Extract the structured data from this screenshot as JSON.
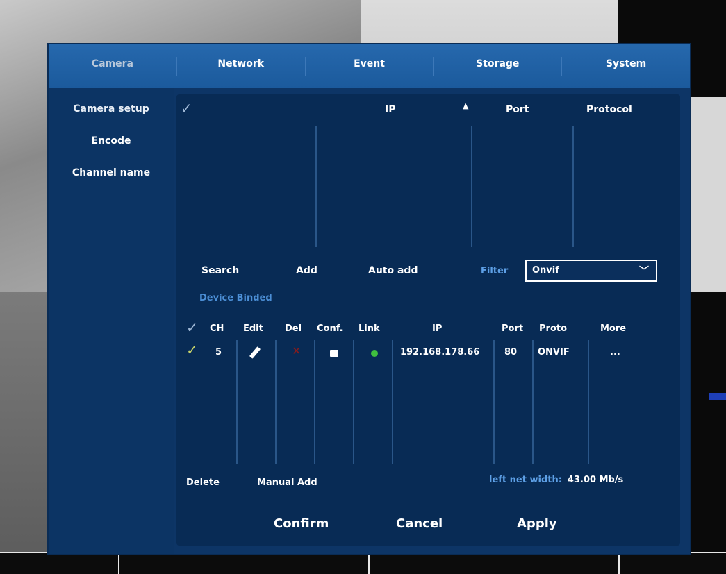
{
  "tabs": [
    "Camera",
    "Network",
    "Event",
    "Storage",
    "System"
  ],
  "sidebar": [
    "Camera setup",
    "Encode",
    "Channel name"
  ],
  "search_table": {
    "headers": {
      "ip": "IP",
      "sort_icon": "sort-ascending-icon",
      "port": "Port",
      "protocol": "Protocol"
    }
  },
  "actions": {
    "search": "Search",
    "add": "Add",
    "auto_add": "Auto add"
  },
  "filter": {
    "label": "Filter",
    "value": "Onvif"
  },
  "device_binded": "Device Binded",
  "bound_table": {
    "headers": {
      "ch": "CH",
      "edit": "Edit",
      "del": "Del",
      "conf": "Conf.",
      "link": "Link",
      "ip": "IP",
      "port": "Port",
      "proto": "Proto",
      "more": "More"
    },
    "rows": [
      {
        "ch": "5",
        "ip": "192.168.178.66",
        "port": "80",
        "proto": "ONVIF",
        "more": "...",
        "link_status_color": "#3fbf3f"
      }
    ]
  },
  "footer": {
    "delete": "Delete",
    "manual_add": "Manual Add",
    "net_width_label": "left net width:",
    "net_width_value": "43.00 Mb/s"
  },
  "buttons": {
    "confirm": "Confirm",
    "cancel": "Cancel",
    "apply": "Apply"
  },
  "colors": {
    "dialog_bg": "#0d3566",
    "tab_bar": "#1f5fa2",
    "content_bg": "#082b55",
    "accent_text": "#5ea0e6"
  }
}
